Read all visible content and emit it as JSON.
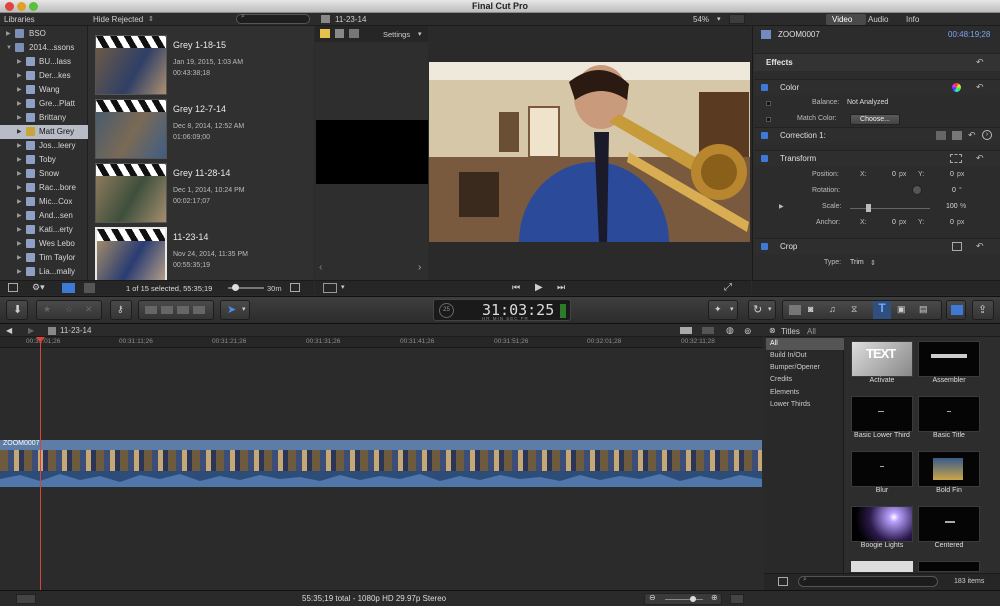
{
  "app": {
    "title": "Final Cut Pro"
  },
  "browser": {
    "libraries_label": "Libraries",
    "filter_label": "Hide Rejected",
    "libraries": [
      {
        "label": "BSO"
      },
      {
        "label": "2014...ssons"
      },
      {
        "label": "BU...lass"
      },
      {
        "label": "Der...kes"
      },
      {
        "label": "Wang"
      },
      {
        "label": "Gre...Platt"
      },
      {
        "label": "Brittany"
      },
      {
        "label": "Matt Grey"
      },
      {
        "label": "Jos...leery"
      },
      {
        "label": "Toby"
      },
      {
        "label": "Snow"
      },
      {
        "label": "Rac...bore"
      },
      {
        "label": "Mic...Cox"
      },
      {
        "label": "And...sen"
      },
      {
        "label": "Kati...erty"
      },
      {
        "label": "Wes Lebo"
      },
      {
        "label": "Tim Taylor"
      },
      {
        "label": "Lia...mally"
      }
    ],
    "clips": [
      {
        "name": "Grey 1-18-15",
        "date": "Jan 19, 2015, 1:03 AM",
        "duration": "00:43:38;18"
      },
      {
        "name": "Grey 12-7-14",
        "date": "Dec 8, 2014, 12:52 AM",
        "duration": "01:06:09;00"
      },
      {
        "name": "Grey 11-28-14",
        "date": "Dec 1, 2014, 10:24 PM",
        "duration": "00:02:17;07"
      },
      {
        "name": "11-23-14",
        "date": "Nov 24, 2014, 11:35 PM",
        "duration": "00:55:35;19"
      }
    ],
    "status": "1 of 15 selected, 55:35;19",
    "zoom_label": "30m"
  },
  "viewer": {
    "title": "11-23-14",
    "zoom": "54%",
    "settings_label": "Settings"
  },
  "inspector": {
    "tabs": [
      "Video",
      "Audio",
      "Info"
    ],
    "clip_name": "ZOOM0007",
    "timecode": "00:48:19;28",
    "effects_label": "Effects",
    "color": {
      "label": "Color",
      "balance_label": "Balance:",
      "balance_value": "Not Analyzed",
      "match_label": "Match Color:",
      "choose_label": "Choose..."
    },
    "correction_label": "Correction 1:",
    "transform": {
      "label": "Transform",
      "position_label": "Position:",
      "x_label": "X:",
      "x_value": "0",
      "y_label": "Y:",
      "y_value": "0",
      "unit_px": "px",
      "rotation_label": "Rotation:",
      "rotation_value": "0",
      "rotation_unit": "°",
      "scale_label": "Scale:",
      "scale_value": "100",
      "scale_unit": "%",
      "anchor_label": "Anchor:",
      "anchor_x_value": "0",
      "anchor_y_value": "0"
    },
    "crop": {
      "label": "Crop",
      "type_label": "Type:",
      "type_value": "Trim"
    }
  },
  "toolbar": {
    "timecode": "31:03:25",
    "tc_small": "25",
    "tc_sub": [
      "HR",
      "MIN",
      "SEC",
      "FR"
    ]
  },
  "timeline": {
    "project_name": "11-23-14",
    "ruler": [
      "00:31:01;26",
      "00:31:11;26",
      "00:31:21;26",
      "00:31:31;26",
      "00:31:41;26",
      "00:31:51;26",
      "00:32:01;28",
      "00:32:11;28"
    ],
    "clip_label": "ZOOM0007",
    "status": "55:35;19 total - 1080p HD 29.97p Stereo"
  },
  "titles_browser": {
    "header": "Titles",
    "header_all": "All",
    "categories": [
      "All",
      "Build In/Out",
      "Bumper/Opener",
      "Credits",
      "Elements",
      "Lower Thirds"
    ],
    "items": [
      {
        "label": "Activate"
      },
      {
        "label": "Assembler"
      },
      {
        "label": "Basic Lower Third"
      },
      {
        "label": "Basic Title"
      },
      {
        "label": "Blur"
      },
      {
        "label": "Bold Fin"
      },
      {
        "label": "Boogie Lights"
      },
      {
        "label": "Centered"
      }
    ],
    "count": "183 items"
  },
  "colors": {
    "accent": "#3d7ad6",
    "playhead": "#d9443a",
    "selection": "#b7bcc6"
  }
}
